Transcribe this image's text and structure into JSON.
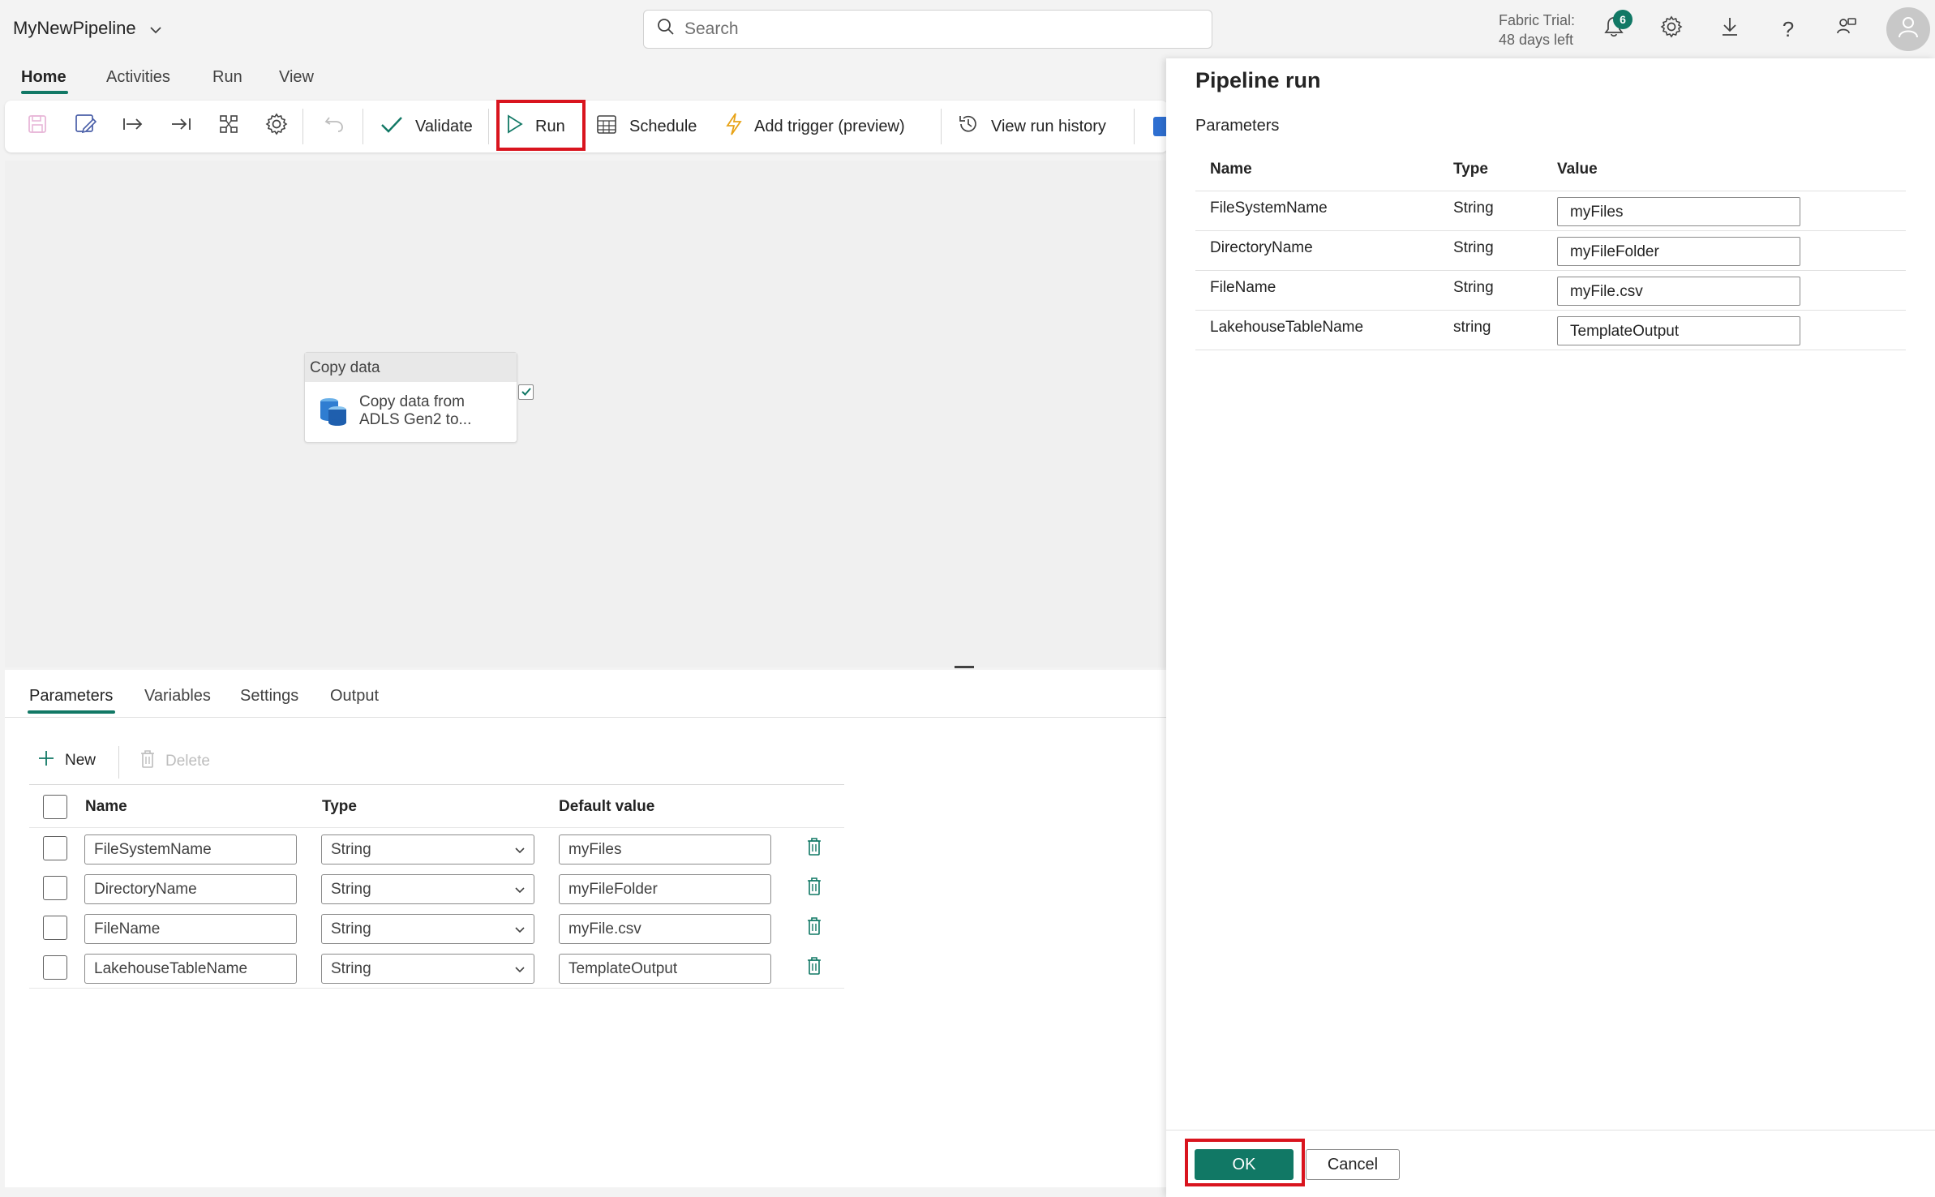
{
  "app": {
    "title": "MyNewPipeline",
    "search_placeholder": "Search",
    "trial_line1": "Fabric Trial:",
    "trial_line2": "48 days left",
    "notification_count": "6",
    "accent_color": "#117865",
    "highlight_color": "#d9141e"
  },
  "main_tabs": [
    "Home",
    "Activities",
    "Run",
    "View"
  ],
  "toolbar": {
    "validate_label": "Validate",
    "run_label": "Run",
    "schedule_label": "Schedule",
    "add_trigger_label": "Add trigger (preview)",
    "view_run_history_label": "View run history"
  },
  "canvas": {
    "activity": {
      "type_label": "Copy data",
      "description_line1": "Copy data from",
      "description_line2": "ADLS Gen2 to..."
    }
  },
  "bottom_panel": {
    "tabs": [
      "Parameters",
      "Variables",
      "Settings",
      "Output"
    ],
    "new_label": "New",
    "delete_label": "Delete",
    "columns": [
      "Name",
      "Type",
      "Default value"
    ],
    "rows": [
      {
        "name": "FileSystemName",
        "type": "String",
        "default": "myFiles"
      },
      {
        "name": "DirectoryName",
        "type": "String",
        "default": "myFileFolder"
      },
      {
        "name": "FileName",
        "type": "String",
        "default": "myFile.csv"
      },
      {
        "name": "LakehouseTableName",
        "type": "String",
        "default": "TemplateOutput"
      }
    ]
  },
  "run_panel": {
    "title": "Pipeline run",
    "section_label": "Parameters",
    "columns": [
      "Name",
      "Type",
      "Value"
    ],
    "rows": [
      {
        "name": "FileSystemName",
        "type": "String",
        "value": "myFiles"
      },
      {
        "name": "DirectoryName",
        "type": "String",
        "value": "myFileFolder"
      },
      {
        "name": "FileName",
        "type": "String",
        "value": "myFile.csv"
      },
      {
        "name": "LakehouseTableName",
        "type": "string",
        "value": "TemplateOutput"
      }
    ],
    "ok_label": "OK",
    "cancel_label": "Cancel"
  }
}
